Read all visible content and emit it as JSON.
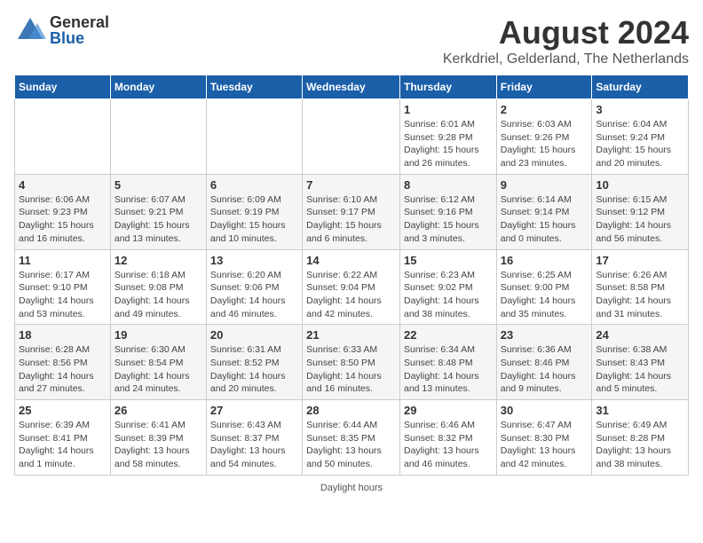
{
  "header": {
    "logo_general": "General",
    "logo_blue": "Blue",
    "month_title": "August 2024",
    "location": "Kerkdriel, Gelderland, The Netherlands"
  },
  "footer": {
    "note": "Daylight hours"
  },
  "days_of_week": [
    "Sunday",
    "Monday",
    "Tuesday",
    "Wednesday",
    "Thursday",
    "Friday",
    "Saturday"
  ],
  "weeks": [
    {
      "days": [
        {
          "num": "",
          "detail": ""
        },
        {
          "num": "",
          "detail": ""
        },
        {
          "num": "",
          "detail": ""
        },
        {
          "num": "",
          "detail": ""
        },
        {
          "num": "1",
          "detail": "Sunrise: 6:01 AM\nSunset: 9:28 PM\nDaylight: 15 hours and 26 minutes."
        },
        {
          "num": "2",
          "detail": "Sunrise: 6:03 AM\nSunset: 9:26 PM\nDaylight: 15 hours and 23 minutes."
        },
        {
          "num": "3",
          "detail": "Sunrise: 6:04 AM\nSunset: 9:24 PM\nDaylight: 15 hours and 20 minutes."
        }
      ]
    },
    {
      "days": [
        {
          "num": "4",
          "detail": "Sunrise: 6:06 AM\nSunset: 9:23 PM\nDaylight: 15 hours and 16 minutes."
        },
        {
          "num": "5",
          "detail": "Sunrise: 6:07 AM\nSunset: 9:21 PM\nDaylight: 15 hours and 13 minutes."
        },
        {
          "num": "6",
          "detail": "Sunrise: 6:09 AM\nSunset: 9:19 PM\nDaylight: 15 hours and 10 minutes."
        },
        {
          "num": "7",
          "detail": "Sunrise: 6:10 AM\nSunset: 9:17 PM\nDaylight: 15 hours and 6 minutes."
        },
        {
          "num": "8",
          "detail": "Sunrise: 6:12 AM\nSunset: 9:16 PM\nDaylight: 15 hours and 3 minutes."
        },
        {
          "num": "9",
          "detail": "Sunrise: 6:14 AM\nSunset: 9:14 PM\nDaylight: 15 hours and 0 minutes."
        },
        {
          "num": "10",
          "detail": "Sunrise: 6:15 AM\nSunset: 9:12 PM\nDaylight: 14 hours and 56 minutes."
        }
      ]
    },
    {
      "days": [
        {
          "num": "11",
          "detail": "Sunrise: 6:17 AM\nSunset: 9:10 PM\nDaylight: 14 hours and 53 minutes."
        },
        {
          "num": "12",
          "detail": "Sunrise: 6:18 AM\nSunset: 9:08 PM\nDaylight: 14 hours and 49 minutes."
        },
        {
          "num": "13",
          "detail": "Sunrise: 6:20 AM\nSunset: 9:06 PM\nDaylight: 14 hours and 46 minutes."
        },
        {
          "num": "14",
          "detail": "Sunrise: 6:22 AM\nSunset: 9:04 PM\nDaylight: 14 hours and 42 minutes."
        },
        {
          "num": "15",
          "detail": "Sunrise: 6:23 AM\nSunset: 9:02 PM\nDaylight: 14 hours and 38 minutes."
        },
        {
          "num": "16",
          "detail": "Sunrise: 6:25 AM\nSunset: 9:00 PM\nDaylight: 14 hours and 35 minutes."
        },
        {
          "num": "17",
          "detail": "Sunrise: 6:26 AM\nSunset: 8:58 PM\nDaylight: 14 hours and 31 minutes."
        }
      ]
    },
    {
      "days": [
        {
          "num": "18",
          "detail": "Sunrise: 6:28 AM\nSunset: 8:56 PM\nDaylight: 14 hours and 27 minutes."
        },
        {
          "num": "19",
          "detail": "Sunrise: 6:30 AM\nSunset: 8:54 PM\nDaylight: 14 hours and 24 minutes."
        },
        {
          "num": "20",
          "detail": "Sunrise: 6:31 AM\nSunset: 8:52 PM\nDaylight: 14 hours and 20 minutes."
        },
        {
          "num": "21",
          "detail": "Sunrise: 6:33 AM\nSunset: 8:50 PM\nDaylight: 14 hours and 16 minutes."
        },
        {
          "num": "22",
          "detail": "Sunrise: 6:34 AM\nSunset: 8:48 PM\nDaylight: 14 hours and 13 minutes."
        },
        {
          "num": "23",
          "detail": "Sunrise: 6:36 AM\nSunset: 8:46 PM\nDaylight: 14 hours and 9 minutes."
        },
        {
          "num": "24",
          "detail": "Sunrise: 6:38 AM\nSunset: 8:43 PM\nDaylight: 14 hours and 5 minutes."
        }
      ]
    },
    {
      "days": [
        {
          "num": "25",
          "detail": "Sunrise: 6:39 AM\nSunset: 8:41 PM\nDaylight: 14 hours and 1 minute."
        },
        {
          "num": "26",
          "detail": "Sunrise: 6:41 AM\nSunset: 8:39 PM\nDaylight: 13 hours and 58 minutes."
        },
        {
          "num": "27",
          "detail": "Sunrise: 6:43 AM\nSunset: 8:37 PM\nDaylight: 13 hours and 54 minutes."
        },
        {
          "num": "28",
          "detail": "Sunrise: 6:44 AM\nSunset: 8:35 PM\nDaylight: 13 hours and 50 minutes."
        },
        {
          "num": "29",
          "detail": "Sunrise: 6:46 AM\nSunset: 8:32 PM\nDaylight: 13 hours and 46 minutes."
        },
        {
          "num": "30",
          "detail": "Sunrise: 6:47 AM\nSunset: 8:30 PM\nDaylight: 13 hours and 42 minutes."
        },
        {
          "num": "31",
          "detail": "Sunrise: 6:49 AM\nSunset: 8:28 PM\nDaylight: 13 hours and 38 minutes."
        }
      ]
    }
  ]
}
